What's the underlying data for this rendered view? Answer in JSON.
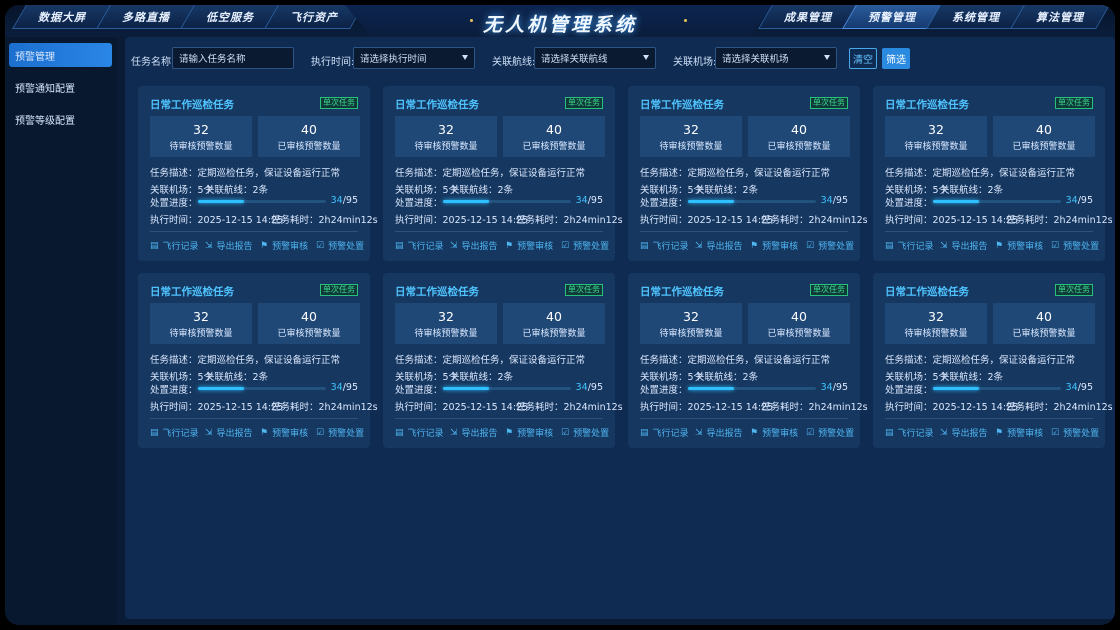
{
  "app_title": "无人机管理系统",
  "nav_left": [
    "数据大屏",
    "多路直播",
    "低空服务",
    "飞行资产"
  ],
  "nav_right": [
    "成果管理",
    "预警管理",
    "系统管理",
    "算法管理"
  ],
  "nav_active": "预警管理",
  "sidebar": {
    "items": [
      {
        "label": "预警管理",
        "active": true
      },
      {
        "label": "预警通知配置",
        "active": false
      },
      {
        "label": "预警等级配置",
        "active": false
      }
    ]
  },
  "filters": {
    "task_name": {
      "label": "任务名称:",
      "placeholder": "请输入任务名称"
    },
    "exec_time": {
      "label": "执行时间:",
      "placeholder": "请选择执行时间"
    },
    "route": {
      "label": "关联航线:",
      "placeholder": "请选择关联航线"
    },
    "airport": {
      "label": "关联机场:",
      "placeholder": "请选择关联机场"
    },
    "clear_label": "清空",
    "filter_label": "筛选"
  },
  "card_labels": {
    "pending": "待审核预警数量",
    "reviewed": "已审核预警数量",
    "desc_prefix": "任务描述：",
    "airport_prefix": "关联机场：",
    "route_prefix": "关联航线：",
    "progress_prefix": "处置进度：",
    "exec_prefix": "执行时间：",
    "duration_prefix": "任务耗时：",
    "actions": [
      {
        "label": "飞行记录",
        "icon": "flight-record-icon",
        "glyph": "▤"
      },
      {
        "label": "导出报告",
        "icon": "export-icon",
        "glyph": "⇲"
      },
      {
        "label": "预警审核",
        "icon": "review-icon",
        "glyph": "⚑"
      },
      {
        "label": "预警处置",
        "icon": "handle-icon",
        "glyph": "☑"
      }
    ]
  },
  "cards": [
    {
      "title": "日常工作巡检任务",
      "tag": "单次任务",
      "pending": "32",
      "reviewed": "40",
      "desc": "定期巡检任务，保证设备运行正常",
      "airports": "5个",
      "routes": "2条",
      "progress_current": "34",
      "progress_total": "/95",
      "progress_fraction": 0.358,
      "exec_time": "2025-12-15 14:25",
      "duration": "2h24min12s"
    },
    {
      "title": "日常工作巡检任务",
      "tag": "单次任务",
      "pending": "32",
      "reviewed": "40",
      "desc": "定期巡检任务，保证设备运行正常",
      "airports": "5个",
      "routes": "2条",
      "progress_current": "34",
      "progress_total": "/95",
      "progress_fraction": 0.358,
      "exec_time": "2025-12-15 14:25",
      "duration": "2h24min12s"
    },
    {
      "title": "日常工作巡检任务",
      "tag": "单次任务",
      "pending": "32",
      "reviewed": "40",
      "desc": "定期巡检任务，保证设备运行正常",
      "airports": "5个",
      "routes": "2条",
      "progress_current": "34",
      "progress_total": "/95",
      "progress_fraction": 0.358,
      "exec_time": "2025-12-15 14:25",
      "duration": "2h24min12s"
    },
    {
      "title": "日常工作巡检任务",
      "tag": "单次任务",
      "pending": "32",
      "reviewed": "40",
      "desc": "定期巡检任务，保证设备运行正常",
      "airports": "5个",
      "routes": "2条",
      "progress_current": "34",
      "progress_total": "/95",
      "progress_fraction": 0.358,
      "exec_time": "2025-12-15 14:25",
      "duration": "2h24min12s"
    },
    {
      "title": "日常工作巡检任务",
      "tag": "单次任务",
      "pending": "32",
      "reviewed": "40",
      "desc": "定期巡检任务，保证设备运行正常",
      "airports": "5个",
      "routes": "2条",
      "progress_current": "34",
      "progress_total": "/95",
      "progress_fraction": 0.358,
      "exec_time": "2025-12-15 14:25",
      "duration": "2h24min12s"
    },
    {
      "title": "日常工作巡检任务",
      "tag": "单次任务",
      "pending": "32",
      "reviewed": "40",
      "desc": "定期巡检任务，保证设备运行正常",
      "airports": "5个",
      "routes": "2条",
      "progress_current": "34",
      "progress_total": "/95",
      "progress_fraction": 0.358,
      "exec_time": "2025-12-15 14:25",
      "duration": "2h24min12s"
    },
    {
      "title": "日常工作巡检任务",
      "tag": "单次任务",
      "pending": "32",
      "reviewed": "40",
      "desc": "定期巡检任务，保证设备运行正常",
      "airports": "5个",
      "routes": "2条",
      "progress_current": "34",
      "progress_total": "/95",
      "progress_fraction": 0.358,
      "exec_time": "2025-12-15 14:25",
      "duration": "2h24min12s"
    },
    {
      "title": "日常工作巡检任务",
      "tag": "单次任务",
      "pending": "32",
      "reviewed": "40",
      "desc": "定期巡检任务，保证设备运行正常",
      "airports": "5个",
      "routes": "2条",
      "progress_current": "34",
      "progress_total": "/95",
      "progress_fraction": 0.358,
      "exec_time": "2025-12-15 14:25",
      "duration": "2h24min12s"
    }
  ],
  "colors": {
    "accent": "#2ec0ff",
    "tag_green": "#39d98e",
    "card_title": "#4fc4ff",
    "active_menu": "#2a86e6"
  }
}
